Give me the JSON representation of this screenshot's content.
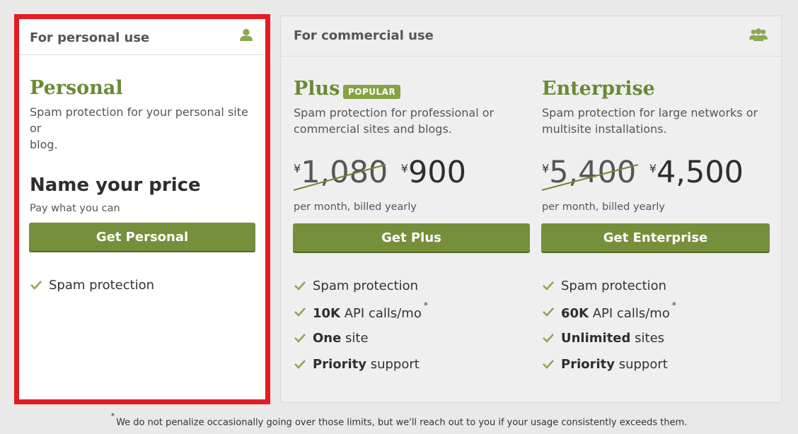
{
  "personal_panel": {
    "header": "For personal use",
    "icon": "user-icon",
    "plan_name": "Personal",
    "description_lines": [
      "Spam protection for your personal site or",
      "blog."
    ],
    "price_title": "Name your price",
    "price_subtitle": "Pay what you can",
    "cta_label": "Get Personal",
    "features": [
      {
        "text": "Spam protection"
      }
    ]
  },
  "commercial_panel": {
    "header": "For commercial use",
    "icon": "users-group-icon",
    "plans": [
      {
        "name": "Plus",
        "badge": "POPULAR",
        "description_lines": [
          "Spam protection for professional or",
          "commercial sites and blogs."
        ],
        "currency": "¥",
        "old_price": "1,080",
        "new_price": "900",
        "billing": "per month, billed yearly",
        "cta_label": "Get Plus",
        "features": [
          {
            "bold": "",
            "text": "Spam protection",
            "star": ""
          },
          {
            "bold": "10K",
            "text": " API calls/mo",
            "star": "*"
          },
          {
            "bold": "One",
            "text": " site",
            "star": ""
          },
          {
            "bold": "Priority",
            "text": " support",
            "star": ""
          }
        ]
      },
      {
        "name": "Enterprise",
        "badge": "",
        "description_lines": [
          "Spam protection for large networks or",
          "multisite installations."
        ],
        "currency": "¥",
        "old_price": "5,400",
        "new_price": "4,500",
        "billing": "per month, billed yearly",
        "cta_label": "Get Enterprise",
        "features": [
          {
            "bold": "",
            "text": "Spam protection",
            "star": ""
          },
          {
            "bold": "60K",
            "text": " API calls/mo",
            "star": "*"
          },
          {
            "bold": "Unlimited",
            "text": " sites",
            "star": ""
          },
          {
            "bold": "Priority",
            "text": " support",
            "star": ""
          }
        ]
      }
    ]
  },
  "footnote": {
    "star": "*",
    "text": "We do not penalize occasionally going over those limits, but we'll reach out to you if your usage consistently exceeds them."
  },
  "colors": {
    "accent_green": "#6a8a34",
    "button_green": "#768f3b",
    "check_green": "#8aa851",
    "highlight_border": "#e41b23"
  }
}
